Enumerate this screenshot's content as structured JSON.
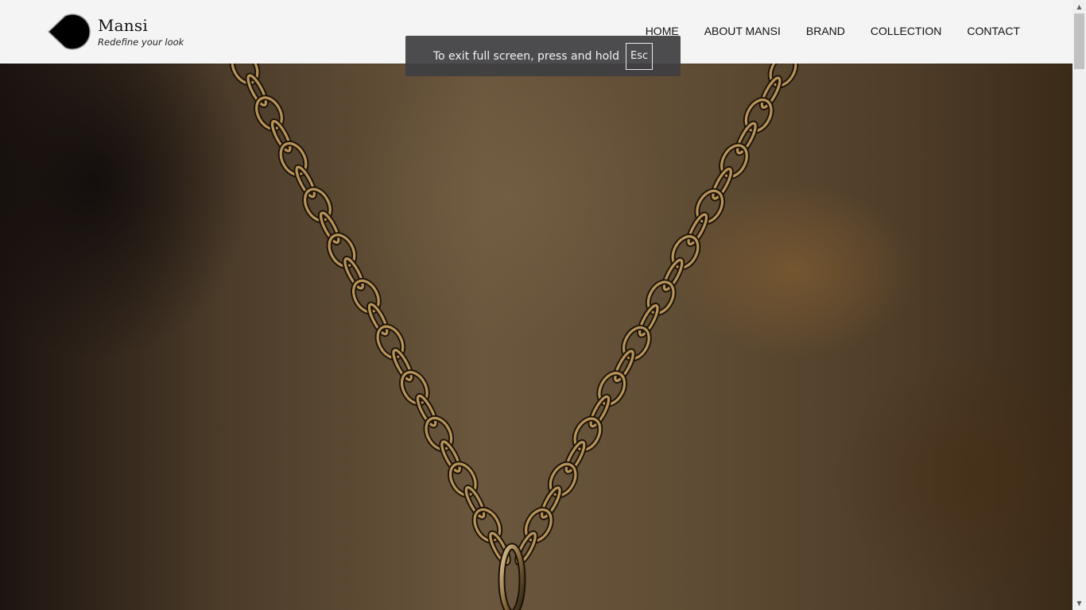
{
  "brand": {
    "name": "Mansi",
    "tagline": "Redefine your look"
  },
  "nav": {
    "items": [
      {
        "label": "HOME"
      },
      {
        "label": "ABOUT MANSI"
      },
      {
        "label": "BRAND"
      },
      {
        "label": "COLLECTION"
      },
      {
        "label": "CONTACT"
      }
    ]
  },
  "fullscreen_notice": {
    "text": "To exit full screen, press and hold",
    "key": "Esc"
  },
  "hero": {
    "image": "gold-chain-necklace-photo"
  },
  "scrollbar": {
    "up_icon": "▲",
    "down_icon": "▼"
  }
}
